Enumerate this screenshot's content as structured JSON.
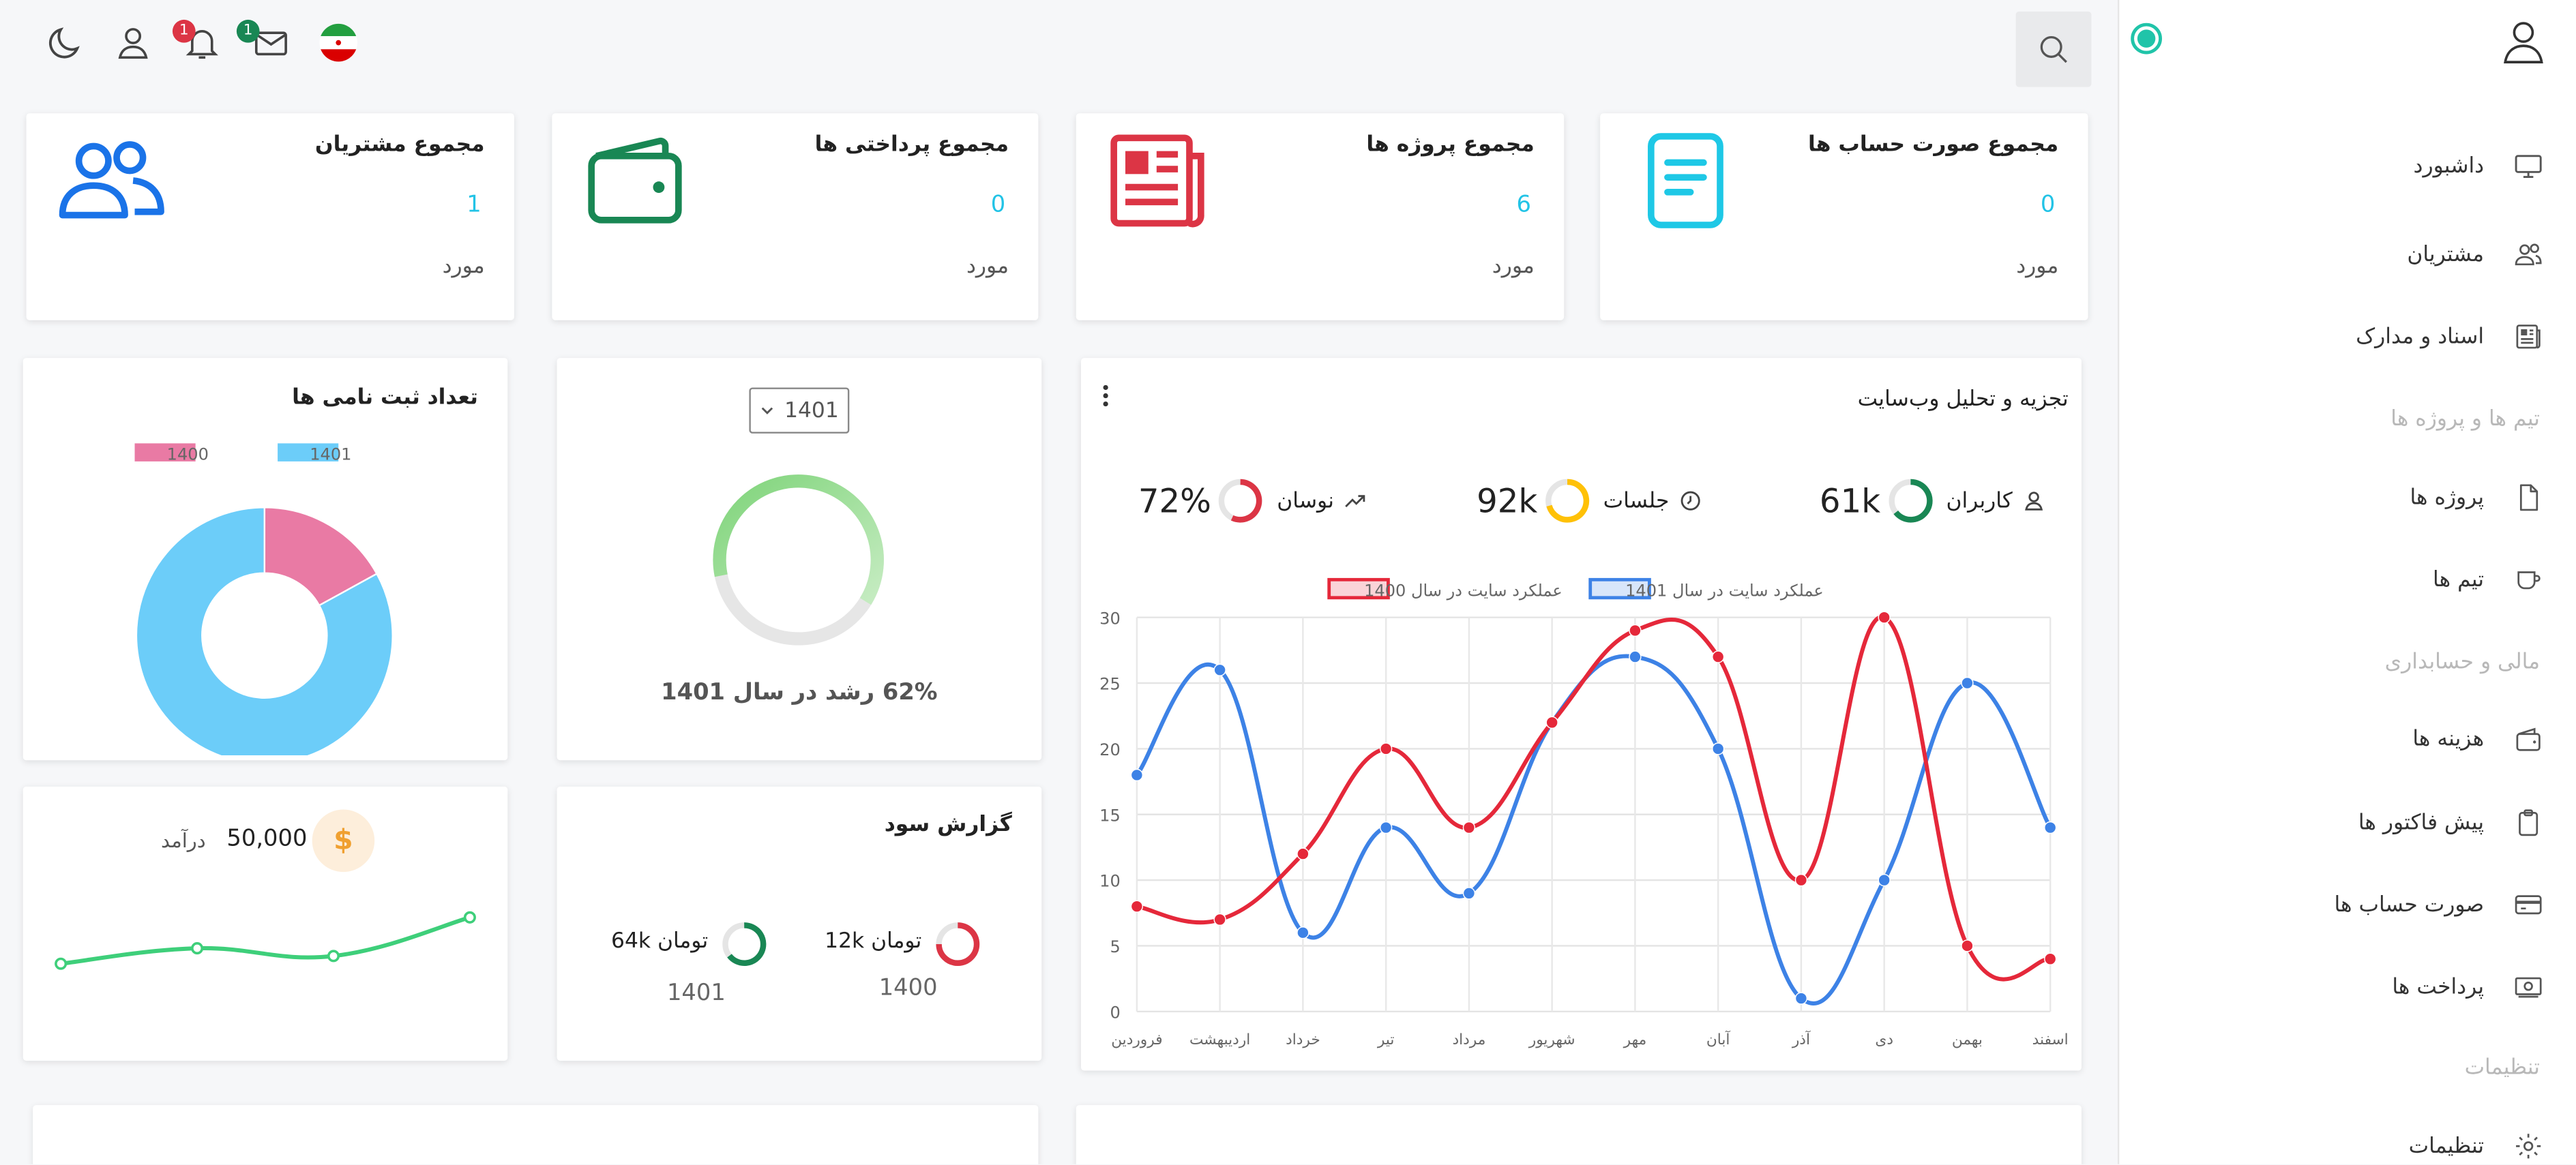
{
  "topbar": {
    "badges": {
      "notifications": "1",
      "messages": "1"
    }
  },
  "sidebar": {
    "items": [
      {
        "label": "داشبورد",
        "icon": "monitor-icon"
      },
      {
        "label": "مشتریان",
        "icon": "users-icon"
      },
      {
        "label": "اسناد و مدارک",
        "icon": "newspaper-icon"
      },
      {
        "label": "پروژه ها",
        "icon": "file-icon"
      },
      {
        "label": "تیم ها",
        "icon": "cup-icon"
      },
      {
        "label": "هزینه ها",
        "icon": "wallet-icon"
      },
      {
        "label": "پیش فاکتور ها",
        "icon": "clipboard-icon"
      },
      {
        "label": "صورت حساب ها",
        "icon": "credit-card-icon"
      },
      {
        "label": "پرداخت ها",
        "icon": "cash-icon"
      },
      {
        "label": "تنظیمات",
        "icon": "gear-icon"
      }
    ],
    "sections": [
      "تیم ها و پروژه ها",
      "مالی و حسابداری",
      "تنظیمات"
    ]
  },
  "stats": [
    {
      "title": "مجموع صورت حساب ها",
      "value": "0",
      "unit": "مورد",
      "icon": "document-icon",
      "color": "#1ec8e6"
    },
    {
      "title": "مجموع پروژه ها",
      "value": "6",
      "unit": "مورد",
      "icon": "newspaper-icon",
      "color": "#dc3545"
    },
    {
      "title": "مجموع پرداختی ها",
      "value": "0",
      "unit": "مورد",
      "icon": "wallet-icon",
      "color": "#198754"
    },
    {
      "title": "مجموع مشتریان",
      "value": "1",
      "unit": "مورد",
      "icon": "users-icon",
      "color": "#1a73e8"
    }
  ],
  "analytics": {
    "title": "تجزیه و تحلیل وب‌سایت",
    "metrics": [
      {
        "label": "کاربران",
        "value": "61k",
        "color": "#198754",
        "icon": "user-icon"
      },
      {
        "label": "جلسات",
        "value": "92k",
        "color": "#ffc107",
        "icon": "clock-icon"
      },
      {
        "label": "نوسان",
        "value": "72%",
        "color": "#dc3545",
        "icon": "trending-icon"
      }
    ]
  },
  "growth": {
    "year_select": "1401",
    "caption": "62% رشد در سال 1401",
    "percent": 62
  },
  "registrations": {
    "title": "تعداد ثبت نامی ها"
  },
  "profit": {
    "title": "گزارش سود",
    "items": [
      {
        "amount": "12k تومان",
        "year": "1400",
        "color": "#dc3545"
      },
      {
        "amount": "64k تومان",
        "year": "1401",
        "color": "#198754"
      }
    ]
  },
  "income": {
    "label": "درآمد",
    "value": "50,000",
    "currency_symbol": "$"
  },
  "chart_data": [
    {
      "type": "line",
      "title": "",
      "categories": [
        "فروردین",
        "اردیبهشت",
        "خرداد",
        "تیر",
        "مرداد",
        "شهریور",
        "مهر",
        "آبان",
        "آذر",
        "دی",
        "بهمن",
        "اسفند"
      ],
      "series": [
        {
          "name": "عملکرد سایت در سال 1401",
          "color": "#3d82e6",
          "values": [
            18,
            26,
            6,
            14,
            9,
            22,
            27,
            20,
            1,
            10,
            25,
            14
          ]
        },
        {
          "name": "عملکرد سایت در سال 1400",
          "color": "#e5283a",
          "values": [
            8,
            7,
            12,
            20,
            14,
            22,
            29,
            27,
            10,
            30,
            5,
            4
          ]
        }
      ],
      "ylim": [
        0,
        30
      ],
      "yticks": [
        0,
        5,
        10,
        15,
        20,
        25,
        30
      ],
      "legend": "top",
      "grid": true
    },
    {
      "type": "pie",
      "title": "تعداد ثبت نامی ها",
      "categories": [
        "1401",
        "1400"
      ],
      "values": [
        83,
        17
      ],
      "colors": [
        "#6ccdf9",
        "#e97aa4"
      ],
      "legend": "top"
    },
    {
      "type": "line",
      "title": "",
      "values": [
        3,
        5,
        4,
        9
      ],
      "color": "#3ecf7a",
      "grid": false
    }
  ]
}
